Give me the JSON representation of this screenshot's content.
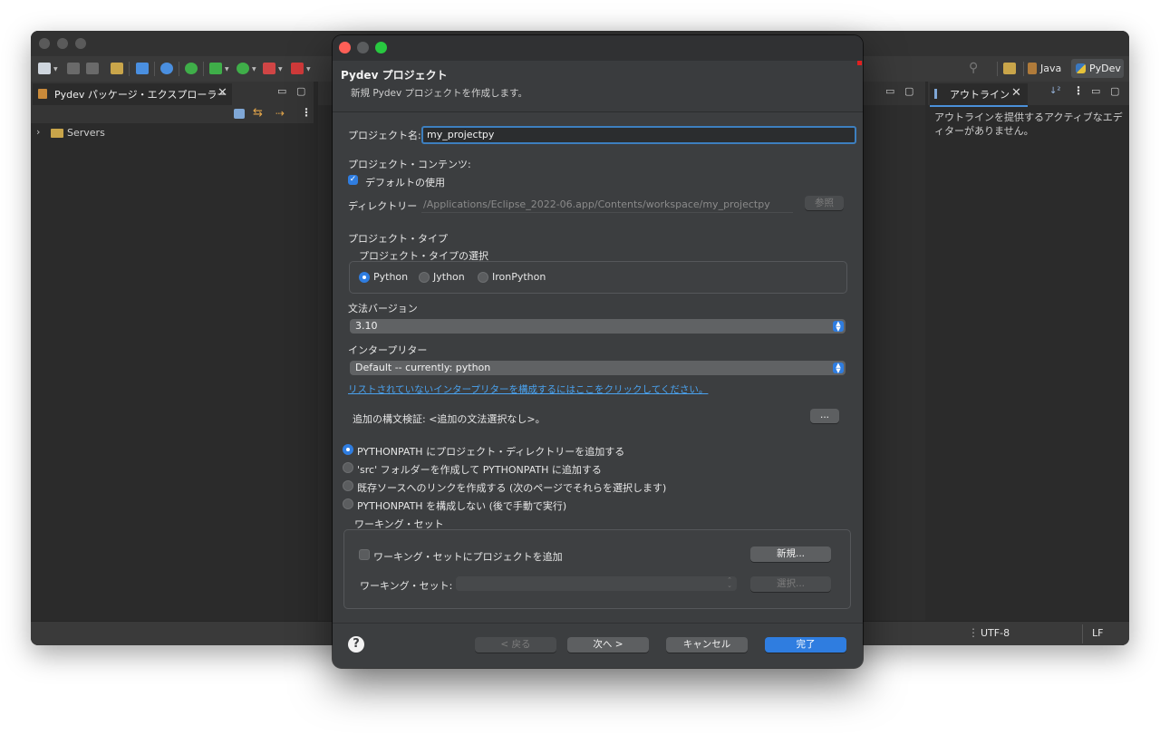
{
  "ide": {
    "toolbar_right": {
      "perspective_java": "Java",
      "perspective_pydev": "PyDev"
    },
    "left_view": {
      "tab_title": "Pydev パッケージ・エクスプローラー",
      "tree_item": "Servers"
    },
    "right_view": {
      "tab_title": "アウトライン",
      "message": "アウトラインを提供するアクティブなエディターがありません。"
    },
    "status": {
      "encoding": "UTF-8",
      "line_ending": "LF"
    }
  },
  "dialog": {
    "title": "Pydev プロジェクト",
    "subtitle": "新規 Pydev プロジェクトを作成します。",
    "project_name_label": "プロジェクト名:",
    "project_name_value": "my_projectpy",
    "contents_label": "プロジェクト・コンテンツ:",
    "use_default_label": "デフォルトの使用",
    "directory_label": "ディレクトリー",
    "directory_value": "/Applications/Eclipse_2022-06.app/Contents/workspace/my_projectpy",
    "browse_button": "参照",
    "type_label": "プロジェクト・タイプ",
    "type_select_label": "プロジェクト・タイプの選択",
    "type_options": [
      "Python",
      "Jython",
      "IronPython"
    ],
    "grammar_label": "文法バージョン",
    "grammar_value": "3.10",
    "interpreter_label": "インタープリター",
    "interpreter_value": "Default  --  currently: python",
    "interpreter_link": "リストされていないインタープリターを構成するにはここをクリックしてください。",
    "extra_syntax_label": "追加の構文検証: <追加の文法選択なし>。",
    "extra_syntax_button": "...",
    "pythonpath_options": [
      "PYTHONPATH にプロジェクト・ディレクトリーを追加する",
      "'src' フォルダーを作成して PYTHONPATH に追加する",
      "既存ソースへのリンクを作成する (次のページでそれらを選択します)",
      "PYTHONPATH を構成しない (後で手動で実行)"
    ],
    "working_set_group": "ワーキング・セット",
    "add_to_working_set_label": "ワーキング・セットにプロジェクトを追加",
    "new_button": "新規...",
    "working_set_label": "ワーキング・セット:",
    "select_button": "選択...",
    "back_button": "< 戻る",
    "next_button": "次へ >",
    "cancel_button": "キャンセル",
    "finish_button": "完了"
  },
  "colors": {
    "accent": "#2f7de0",
    "link": "#4aa3f0",
    "dialog_bg": "#3c3e40",
    "ide_bg": "#2b2b2b"
  }
}
